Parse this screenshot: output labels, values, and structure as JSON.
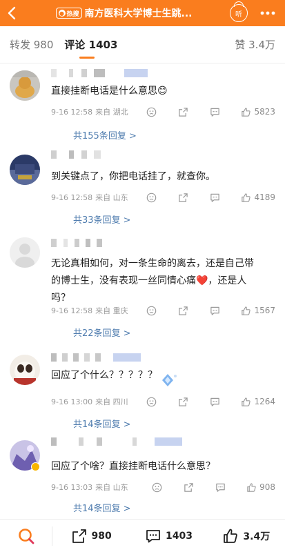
{
  "header": {
    "hot_badge": "热搜",
    "title": "南方医科大学博士生跳...",
    "listen_label": "听"
  },
  "tabs": [
    {
      "label": "转发 980"
    },
    {
      "label": "评论 1403"
    },
    {
      "label": "赞 3.4万"
    }
  ],
  "comments": [
    {
      "text": "直接挂断电话是什么意思😊",
      "time": "9-16 12:58",
      "source": "来自 湖北",
      "likes": "5823",
      "replies": "共155条回复 >"
    },
    {
      "text": "到关键点了，你把电话挂了，就查你。",
      "time": "9-16 12:58",
      "source": "来自 山东",
      "likes": "4189",
      "replies": "共33条回复 >"
    },
    {
      "text_l1": "无论真相如何，对一条生命的离去，还是自己带",
      "text_l2": "的博士生，没有表现一丝同情心痛❤️，还是人",
      "text_l3": "吗？",
      "time": "9-16 12:58",
      "source": "来自 重庆",
      "likes": "1567",
      "replies": "共22条回复 >"
    },
    {
      "text": "回应了个什么？？？？？",
      "time": "9-16 13:00",
      "source": "来自 四川",
      "likes": "1264",
      "replies": "共14条回复 >"
    },
    {
      "text": "回应了个啥？直接挂断电话什么意思？",
      "time": "9-16 13:03",
      "source": "来自 山东",
      "likes": "908",
      "replies": "共14条回复 >"
    }
  ],
  "bottom_bar": {
    "reposts": "980",
    "comments": "1403",
    "likes": "3.4万"
  },
  "colors": {
    "brand": "#fa7d1e",
    "link": "#507daf"
  }
}
